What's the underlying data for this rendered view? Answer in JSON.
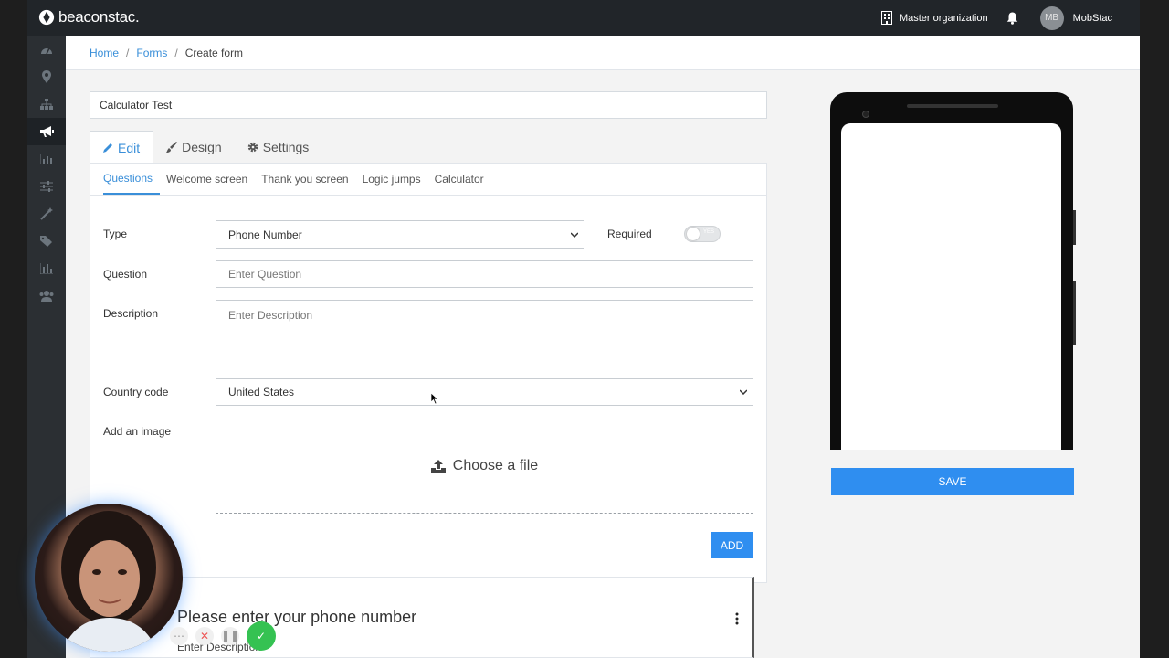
{
  "topbar": {
    "logo_text": "beaconstac.",
    "org_label": "Master organization",
    "avatar_initials": "MB",
    "user_name": "MobStac"
  },
  "sidebar": {
    "items": [
      {
        "icon": "dashboard-icon",
        "active": false
      },
      {
        "icon": "map-pin-icon",
        "active": false
      },
      {
        "icon": "sitemap-icon",
        "active": false
      },
      {
        "icon": "megaphone-icon",
        "active": true
      },
      {
        "icon": "bar-chart-icon",
        "active": false
      },
      {
        "icon": "sliders-icon",
        "active": false
      },
      {
        "icon": "magic-wand-icon",
        "active": false
      },
      {
        "icon": "tags-icon",
        "active": false
      },
      {
        "icon": "analytics-icon",
        "active": false
      },
      {
        "icon": "users-icon",
        "active": false
      }
    ]
  },
  "breadcrumb": {
    "home": "Home",
    "forms": "Forms",
    "current": "Create form",
    "separator": "/"
  },
  "form": {
    "title_value": "Calculator Test",
    "tabs": [
      {
        "label": "Edit",
        "icon": "pencil-icon",
        "active": true
      },
      {
        "label": "Design",
        "icon": "brush-icon",
        "active": false
      },
      {
        "label": "Settings",
        "icon": "gear-icon",
        "active": false
      }
    ],
    "subtabs": [
      "Questions",
      "Welcome screen",
      "Thank you screen",
      "Logic jumps",
      "Calculator"
    ],
    "labels": {
      "type": "Type",
      "required": "Required",
      "question": "Question",
      "description": "Description",
      "country_code": "Country code",
      "add_image": "Add an image"
    },
    "type_selected": "Phone Number",
    "required_toggle_text": "YES",
    "required_on": false,
    "question_placeholder": "Enter Question",
    "description_placeholder": "Enter Description",
    "country_selected": "United States",
    "choose_file": "Choose a file",
    "add_button": "ADD"
  },
  "question_card": {
    "title": "Please enter your phone number",
    "description": "Enter Description"
  },
  "preview": {
    "save_button": "SAVE"
  },
  "colors": {
    "accent": "#2f8ef0",
    "link": "#3a8fd9",
    "topbar": "#212529",
    "sidebar": "#2b2f33"
  }
}
